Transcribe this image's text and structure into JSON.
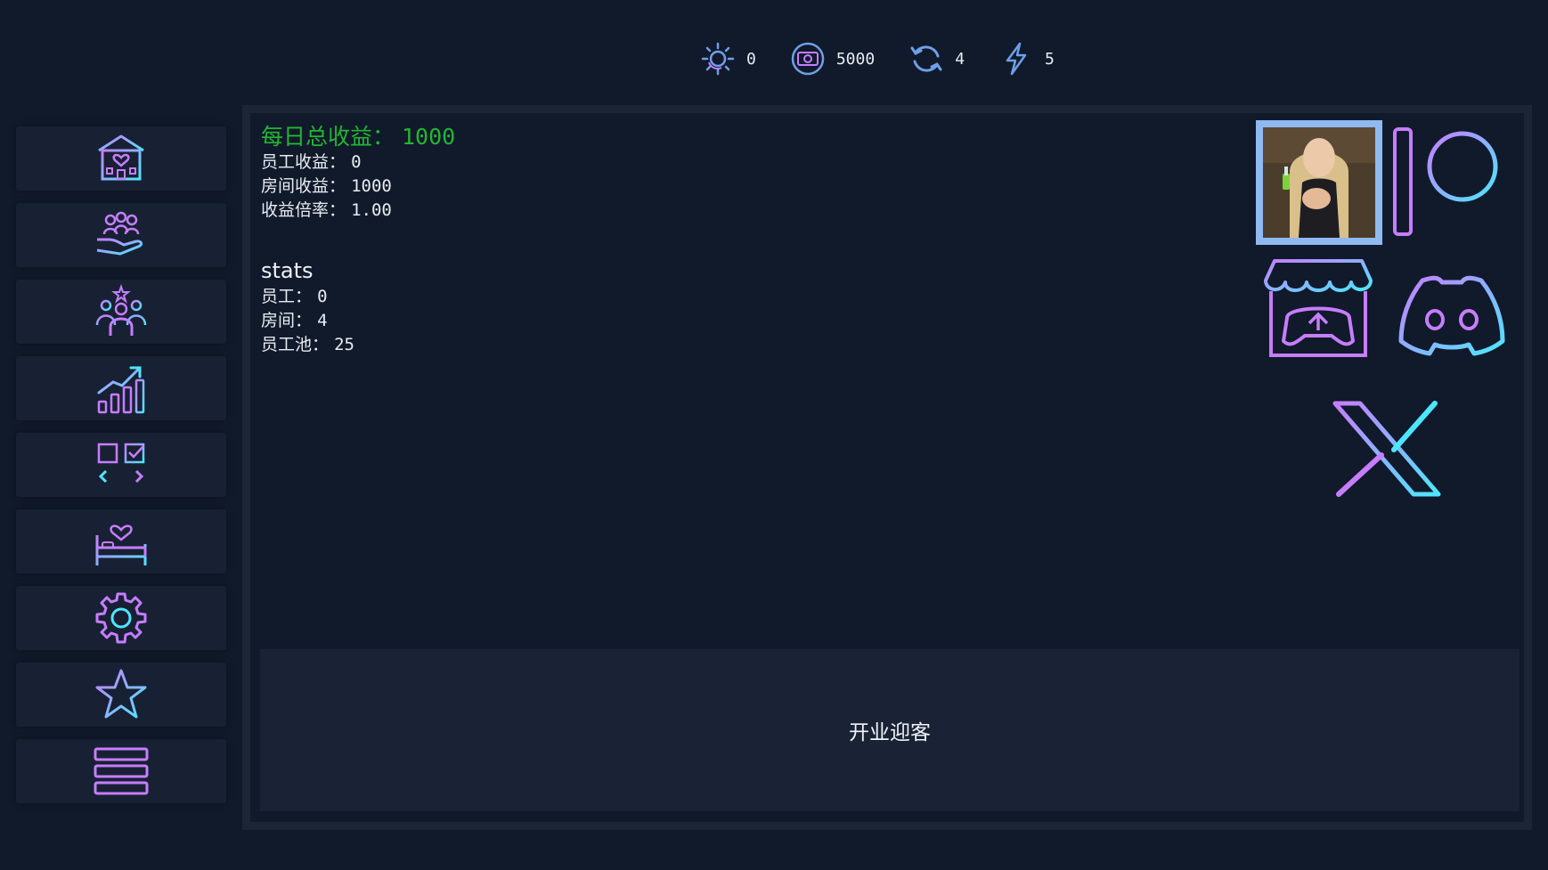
{
  "resources": [
    {
      "name": "reputation",
      "icon": "sun-moon-icon",
      "value": "0"
    },
    {
      "name": "money",
      "icon": "cash-icon",
      "value": "5000"
    },
    {
      "name": "cycle",
      "icon": "refresh-icon",
      "value": "4"
    },
    {
      "name": "energy",
      "icon": "lightning-icon",
      "value": "5"
    }
  ],
  "sidebar": {
    "items": [
      {
        "icon": "hotel-heart-icon"
      },
      {
        "icon": "staff-hand-icon"
      },
      {
        "icon": "team-star-icon"
      },
      {
        "icon": "growth-chart-icon"
      },
      {
        "icon": "task-swap-icon"
      },
      {
        "icon": "bed-heart-icon"
      },
      {
        "icon": "gear-icon"
      },
      {
        "icon": "star-icon"
      },
      {
        "icon": "menu-icon"
      }
    ]
  },
  "income": {
    "total_label": "每日总收益：",
    "total_value": "1000",
    "staff_label": "员工收益：",
    "staff_value": "0",
    "room_label": "房间收益：",
    "room_value": "1000",
    "rate_label": "收益倍率：",
    "rate_value": "1.00"
  },
  "stats": {
    "heading": "stats",
    "staff_label": "员工：",
    "staff_value": "0",
    "rooms_label": "房间：",
    "rooms_value": "4",
    "pool_label": "员工池：",
    "pool_value": "25"
  },
  "open_button": {
    "label": "开业迎客"
  },
  "social": [
    {
      "icon": "character-portrait"
    },
    {
      "icon": "patreon-icon"
    },
    {
      "icon": "itch-io-icon"
    },
    {
      "icon": "discord-icon"
    },
    {
      "icon": "x-twitter-icon"
    }
  ],
  "colors": {
    "background": "#111a2b",
    "income_green": "#22b633",
    "neon_purple": "#c77dff",
    "neon_cyan": "#4ee6ff"
  }
}
